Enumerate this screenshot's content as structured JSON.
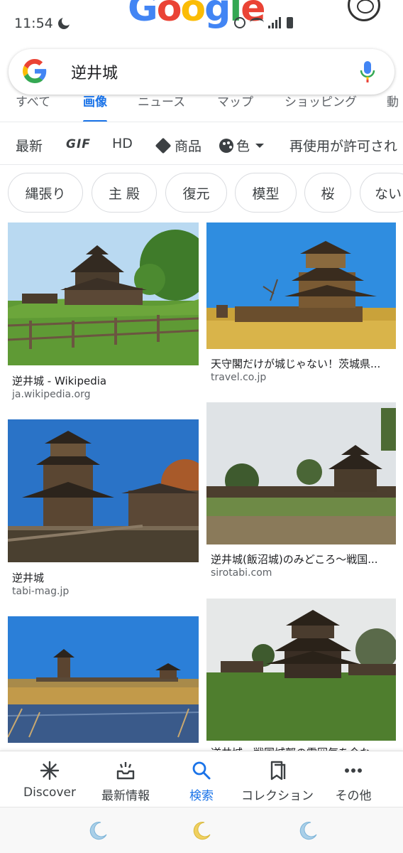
{
  "status_bar": {
    "time": "11:54",
    "doodle_letters": [
      "G",
      "o",
      "o",
      "g",
      "l",
      "e"
    ]
  },
  "search": {
    "query": "逆井城"
  },
  "tabs": [
    {
      "label": "すべて",
      "active": false
    },
    {
      "label": "画像",
      "active": true
    },
    {
      "label": "ニュース",
      "active": false
    },
    {
      "label": "マップ",
      "active": false
    },
    {
      "label": "ショッピング",
      "active": false
    },
    {
      "label": "動",
      "active": false
    }
  ],
  "tools": {
    "latest": "最新",
    "gif": "GIF",
    "hd": "HD",
    "product": "商品",
    "color": "色",
    "reuse": "再使用が許可され"
  },
  "chips": [
    "縄張り",
    "主 殿",
    "復元",
    "模型",
    "桜",
    "ない"
  ],
  "results": [
    {
      "title": "逆井城 - Wikipedia",
      "source": "ja.wikipedia.org"
    },
    {
      "title": "天守閣だけが城じゃない！茨城県...",
      "source": "travel.co.jp"
    },
    {
      "title": "逆井城",
      "source": "tabi-mag.jp"
    },
    {
      "title": "逆井城(飯沼城)のみどころ～戦国...",
      "source": "sirotabi.com"
    },
    {
      "title": "",
      "source": ""
    },
    {
      "title": "逆井城　戦国城郭の雰囲気を今な...",
      "source": ""
    }
  ],
  "bottom_nav": [
    {
      "label": "Discover",
      "icon": "asterisk-icon",
      "active": false
    },
    {
      "label": "最新情報",
      "icon": "updates-tray-icon",
      "active": false
    },
    {
      "label": "検索",
      "icon": "search-icon",
      "active": true
    },
    {
      "label": "コレクション",
      "icon": "bookmark-collection-icon",
      "active": false
    },
    {
      "label": "その他",
      "icon": "more-dots-icon",
      "active": false
    }
  ],
  "colors": {
    "accent": "#1a73e8",
    "text": "#202124",
    "muted": "#5f6368"
  }
}
